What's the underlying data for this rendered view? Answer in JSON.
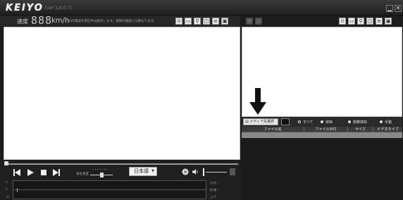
{
  "window": {
    "logo": "KEIYO",
    "version": "[ver 1.0.0.7]",
    "minimize_icon": "minimize-icon",
    "close_icon": "close-icon"
  },
  "speed": {
    "label": "速度",
    "digits": "888",
    "unit": "km/h",
    "note": "GPS電波を受信中は表示します。実際の速度とは異なります。"
  },
  "toolbars": {
    "left_icons": [
      "snapshot-icon",
      "save-icon",
      "zoom-icon",
      "split-icon",
      "print-icon",
      "fullscreen-icon"
    ],
    "center_icons": [
      "map-icon",
      "map-view-icon"
    ],
    "right_icons": [
      "snapshot-icon",
      "save-icon",
      "zoom-icon",
      "split-icon",
      "print-icon",
      "fullscreen-icon"
    ]
  },
  "player": {
    "speed_adjust_label": "再生速度",
    "language": "日本語",
    "graph_y_labels": [
      "G",
      "0",
      "-G"
    ],
    "graph_right_labels": [
      "左/右 :",
      "前/後 :",
      "上/下 :"
    ],
    "colors": {
      "panel": "#1f1f1f",
      "video_bg": "#ffffff"
    }
  },
  "file_panel": {
    "media_button": "メディア先選択",
    "filters": [
      {
        "label": "すべて",
        "selected": false
      },
      {
        "label": "常時",
        "selected": true
      },
      {
        "label": "衝撃検知",
        "selected": true
      },
      {
        "label": "手動",
        "selected": true
      }
    ],
    "columns": [
      "ファイル名",
      "ファイル日付",
      "サイズ",
      "ビデオタイプ"
    ]
  }
}
